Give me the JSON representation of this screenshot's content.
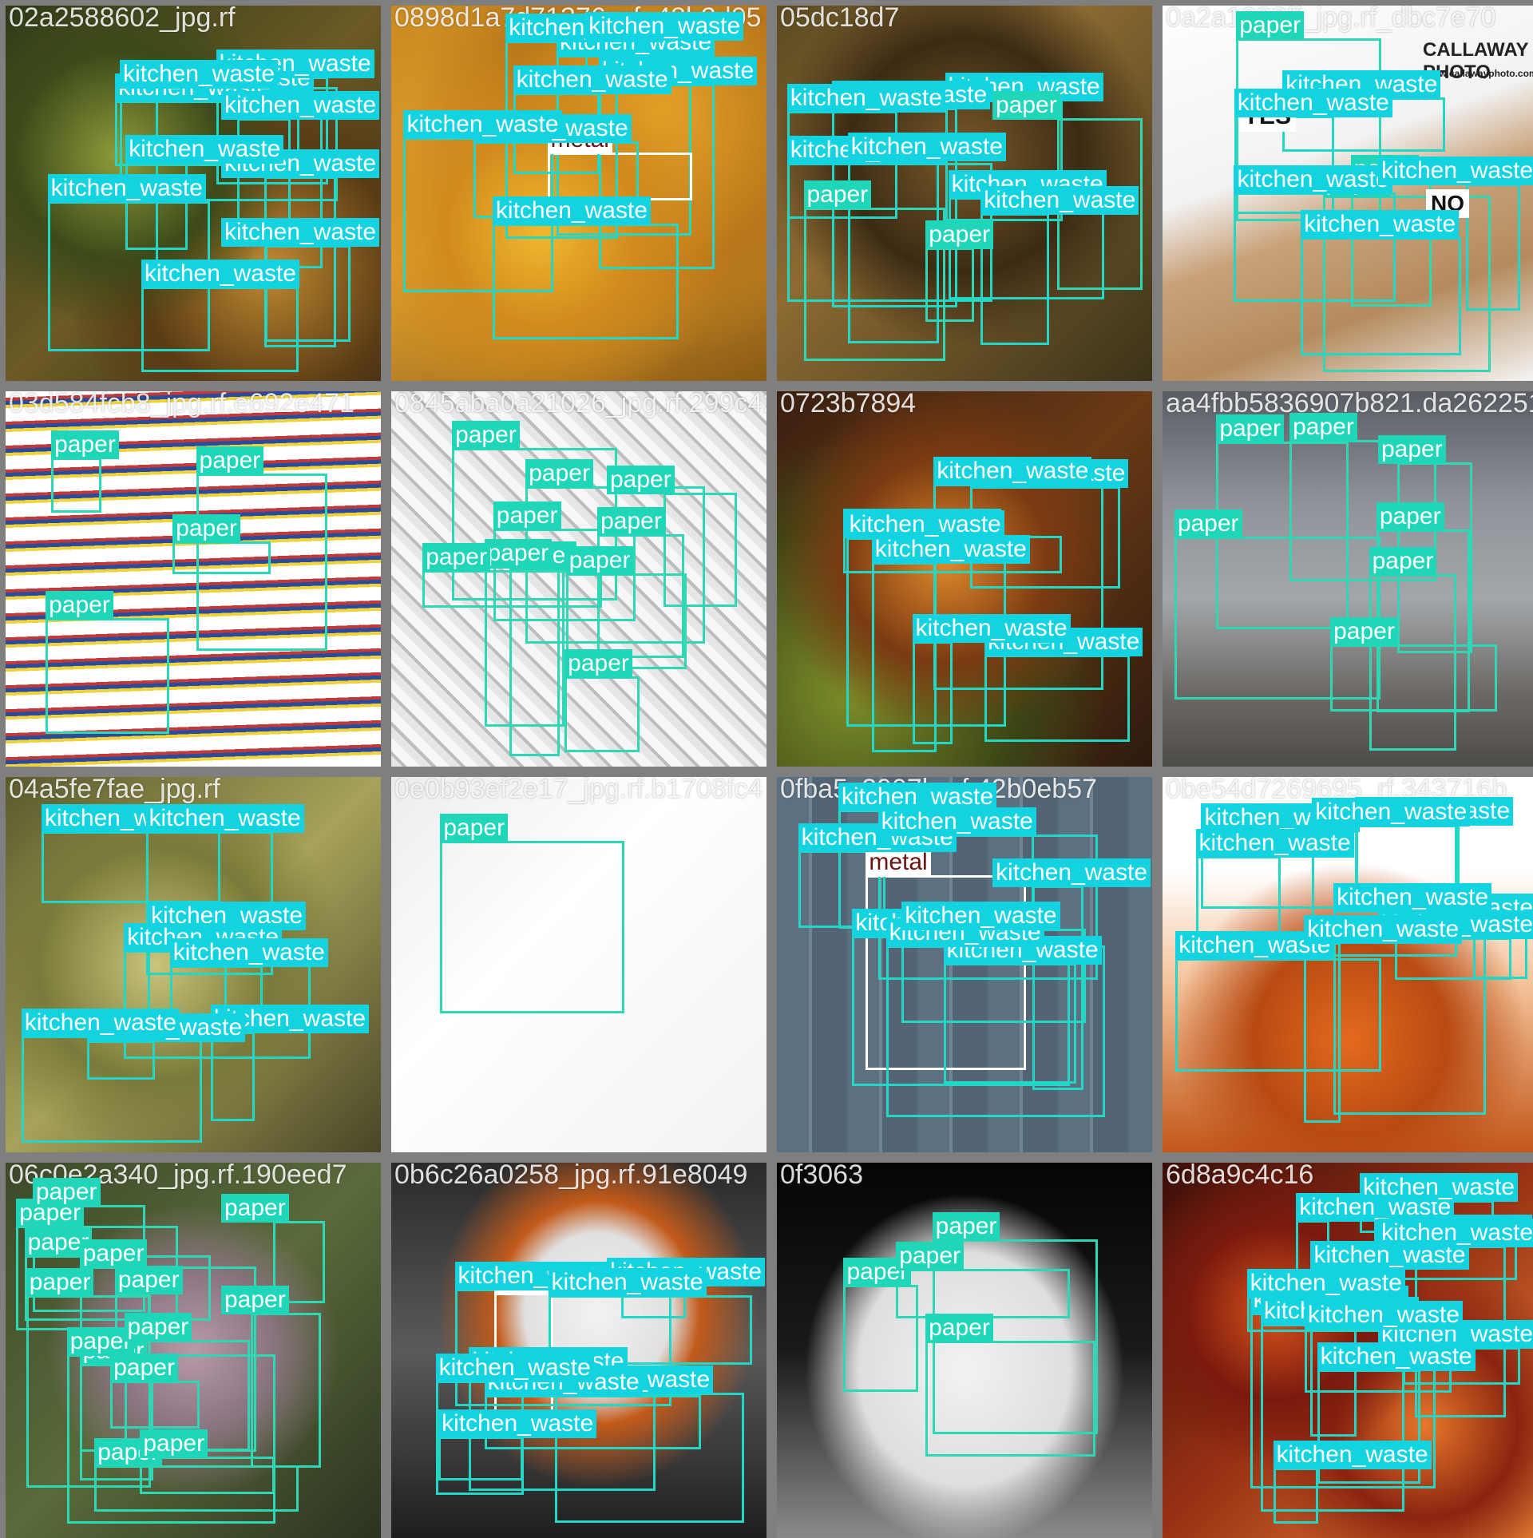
{
  "tiles": [
    {
      "filename": "02a2588602_jpg.rf",
      "background": "compost",
      "labels": [
        [
          "kitchen_waste",
          "kitchen"
        ],
        [
          "kitchen_waste",
          "kitchen"
        ],
        [
          "kitchen_waste",
          "kitchen"
        ],
        [
          "kitchen_waste",
          "kitchen"
        ],
        [
          "kitchen_waste",
          "kitchen"
        ],
        [
          "kitchen_waste",
          "kitchen"
        ],
        [
          "kitchen_waste",
          "kitchen"
        ],
        [
          "kitchen_waste",
          "kitchen"
        ],
        [
          "kitchen_waste",
          "kitchen"
        ],
        [
          "kitchen_waste",
          "kitchen"
        ]
      ]
    },
    {
      "filename": "0898d1a7d71376ccf_48b2d05",
      "background": "peel",
      "labels": [
        [
          "kitchen_waste",
          "kitchen"
        ],
        [
          "kitchen_waste",
          "kitchen"
        ],
        [
          "metal",
          "metal"
        ],
        [
          "kitchen_waste",
          "kitchen"
        ],
        [
          "kitchen_waste",
          "kitchen"
        ],
        [
          "kitchen_waste",
          "kitchen"
        ],
        [
          "kitchen_waste",
          "kitchen"
        ],
        [
          "kitchen_waste",
          "kitchen"
        ],
        [
          "kitchen_waste",
          "kitchen"
        ]
      ]
    },
    {
      "filename": "05dc18d7",
      "background": "dump",
      "labels": [
        [
          "kitchen_waste",
          "kitchen"
        ],
        [
          "kitchen_waste",
          "kitchen"
        ],
        [
          "kitchen_waste",
          "kitchen"
        ],
        [
          "kitchen_waste",
          "kitchen"
        ],
        [
          "paper",
          "paper"
        ],
        [
          "kitchen_waste",
          "kitchen"
        ],
        [
          "paper",
          "paper"
        ],
        [
          "paper",
          "paper"
        ],
        [
          "kitchen_waste",
          "kitchen"
        ],
        [
          "kitchen_waste",
          "kitchen"
        ]
      ]
    },
    {
      "filename": "0a2a1033ff_jpg.rf_dbc7e70",
      "background": "cardboard",
      "labels": [
        [
          "paper",
          "paper"
        ],
        [
          "paper",
          "paper"
        ],
        [
          "paper",
          "paper"
        ],
        [
          "kitchen_waste",
          "kitchen"
        ],
        [
          "kitchen_waste",
          "kitchen"
        ],
        [
          "kitchen_waste",
          "kitchen"
        ],
        [
          "kitchen_waste",
          "kitchen"
        ],
        [
          "kitchen_waste",
          "kitchen"
        ]
      ],
      "overlay_text": [
        "YES",
        "NO",
        "CALLAWAY PHOTO",
        "www.callawayphoto.com"
      ]
    },
    {
      "filename": "03d584fcb8_jpg.rf.e692e471",
      "background": "magazines",
      "labels": [
        [
          "paper",
          "paper"
        ],
        [
          "paper",
          "paper"
        ],
        [
          "paper",
          "paper"
        ],
        [
          "paper",
          "paper"
        ]
      ]
    },
    {
      "filename": "0845aba0a21026_jpg.rf.299c427a",
      "background": "news",
      "labels": [
        [
          "paper",
          "paper"
        ],
        [
          "paper",
          "paper"
        ],
        [
          "paper",
          "paper"
        ],
        [
          "paper",
          "paper"
        ],
        [
          "paper",
          "paper"
        ],
        [
          "paper",
          "paper"
        ],
        [
          "paper",
          "paper"
        ],
        [
          "paper",
          "paper"
        ],
        [
          "paper",
          "paper"
        ],
        [
          "paper",
          "paper"
        ]
      ]
    },
    {
      "filename": "0723b7894",
      "background": "veg",
      "labels": [
        [
          "kitchen_waste",
          "kitchen"
        ],
        [
          "kitchen_waste",
          "kitchen"
        ],
        [
          "kitchen_waste",
          "kitchen"
        ],
        [
          "kitchen_waste",
          "kitchen"
        ],
        [
          "kitchen_waste",
          "kitchen"
        ],
        [
          "kitchen_waste",
          "kitchen"
        ],
        [
          "kitchen_waste",
          "kitchen"
        ]
      ]
    },
    {
      "filename": "aa4fbb5836907b821.da262251",
      "background": "factory",
      "labels": [
        [
          "paper",
          "paper"
        ],
        [
          "paper",
          "paper"
        ],
        [
          "paper",
          "paper"
        ],
        [
          "paper",
          "paper"
        ],
        [
          "paper",
          "paper"
        ],
        [
          "paper",
          "paper"
        ],
        [
          "paper",
          "paper"
        ]
      ]
    },
    {
      "filename": "04a5fe7fae_jpg.rf",
      "background": "scraps",
      "labels": [
        [
          "kitchen_waste",
          "kitchen"
        ],
        [
          "kitchen_waste",
          "kitchen"
        ],
        [
          "kitchen_waste",
          "kitchen"
        ],
        [
          "kitchen_waste",
          "kitchen"
        ],
        [
          "kitchen_waste",
          "kitchen"
        ],
        [
          "kitchen_waste",
          "kitchen"
        ],
        [
          "kitchen_waste",
          "kitchen"
        ],
        [
          "kitchen_waste",
          "kitchen"
        ]
      ]
    },
    {
      "filename": "0e0b93ef2e17_jpg.rf.b1708fc4",
      "background": "brownpaper",
      "labels": [
        [
          "paper",
          "paper"
        ]
      ]
    },
    {
      "filename": "0fba5c2907b_rf.42b0eb57",
      "background": "wood",
      "labels": [
        [
          "metal",
          "metal"
        ],
        [
          "kitchen_waste",
          "kitchen"
        ],
        [
          "kitchen_waste",
          "kitchen"
        ],
        [
          "kitchen_waste",
          "kitchen"
        ],
        [
          "kitchen_waste",
          "kitchen"
        ],
        [
          "kitchen_waste",
          "kitchen"
        ],
        [
          "kitchen_waste",
          "kitchen"
        ],
        [
          "kitchen_waste",
          "kitchen"
        ],
        [
          "kitchen_waste",
          "kitchen"
        ]
      ]
    },
    {
      "filename": "0be54d7269695_rf.343716b",
      "background": "orangeveg",
      "labels": [
        [
          "kitchen_waste",
          "kitchen"
        ],
        [
          "kitchen_waste",
          "kitchen"
        ],
        [
          "kitchen_waste",
          "kitchen"
        ],
        [
          "kitchen_waste",
          "kitchen"
        ],
        [
          "kitchen_waste",
          "kitchen"
        ],
        [
          "kitchen_waste",
          "kitchen"
        ],
        [
          "kitchen_waste",
          "kitchen"
        ],
        [
          "kitchen_waste",
          "kitchen"
        ],
        [
          "kitchen_waste",
          "kitchen"
        ]
      ]
    },
    {
      "filename": "06c0e2a340_jpg.rf.190eed7",
      "background": "grass",
      "labels": [
        [
          "paper",
          "paper"
        ],
        [
          "paper",
          "paper"
        ],
        [
          "paper",
          "paper"
        ],
        [
          "paper",
          "paper"
        ],
        [
          "paper",
          "paper"
        ],
        [
          "paper",
          "paper"
        ],
        [
          "paper",
          "paper"
        ],
        [
          "paper",
          "paper"
        ],
        [
          "paper",
          "paper"
        ],
        [
          "paper",
          "paper"
        ],
        [
          "paper",
          "paper"
        ],
        [
          "paper",
          "paper"
        ],
        [
          "paper",
          "paper"
        ],
        [
          "paper",
          "paper"
        ]
      ]
    },
    {
      "filename": "0b6c26a0258_jpg.rf.91e8049",
      "background": "pot",
      "labels": [
        [
          "metal",
          "metal"
        ],
        [
          "kitchen_waste",
          "kitchen"
        ],
        [
          "kitchen_waste",
          "kitchen"
        ],
        [
          "kitchen_waste",
          "kitchen"
        ],
        [
          "kitchen_waste",
          "kitchen"
        ],
        [
          "kitchen_waste",
          "kitchen"
        ],
        [
          "kitchen_waste",
          "kitchen"
        ],
        [
          "kitchen_waste",
          "kitchen"
        ],
        [
          "kitchen_waste",
          "kitchen"
        ]
      ]
    },
    {
      "filename": "0f3063",
      "background": "tp",
      "labels": [
        [
          "paper",
          "paper"
        ],
        [
          "paper",
          "paper"
        ],
        [
          "paper",
          "paper"
        ],
        [
          "paper",
          "paper"
        ]
      ]
    },
    {
      "filename": "6d8a9c4c16",
      "background": "fruit",
      "labels": [
        [
          "kitchen_waste",
          "kitchen"
        ],
        [
          "kitchen_waste",
          "kitchen"
        ],
        [
          "kitchen_waste",
          "kitchen"
        ],
        [
          "kitchen_waste",
          "kitchen"
        ],
        [
          "kitchen_waste",
          "kitchen"
        ],
        [
          "kitchen_waste",
          "kitchen"
        ],
        [
          "kitchen_waste",
          "kitchen"
        ],
        [
          "kitchen_waste",
          "kitchen"
        ],
        [
          "kitchen_waste",
          "kitchen"
        ],
        [
          "kitchen_waste",
          "kitchen"
        ],
        [
          "kitchen_waste",
          "kitchen"
        ],
        [
          "kitchen_waste",
          "kitchen"
        ]
      ]
    }
  ]
}
